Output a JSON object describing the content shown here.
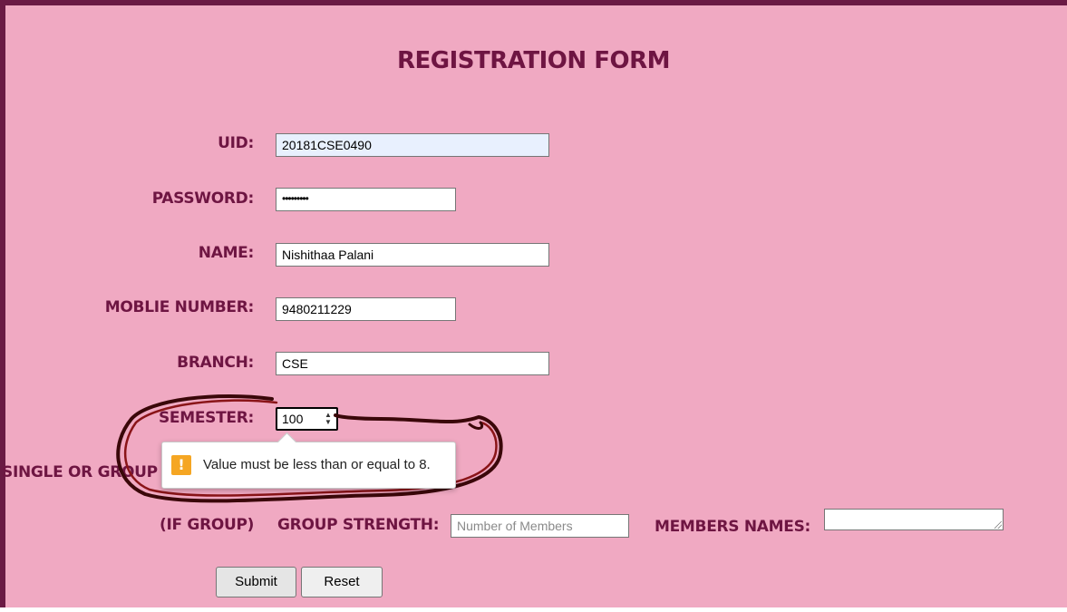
{
  "form": {
    "title": "REGISTRATION FORM",
    "fields": {
      "uid": {
        "label": "UID:",
        "value": "20181CSE0490"
      },
      "password": {
        "label": "PASSWORD:",
        "value": "•••••••••"
      },
      "name": {
        "label": "NAME:",
        "value": "Nishithaa Palani"
      },
      "mobile": {
        "label": "MOBLIE NUMBER:",
        "value": "9480211229"
      },
      "branch": {
        "label": "BRANCH:",
        "value": "CSE"
      },
      "semester": {
        "label": "SEMESTER:",
        "value": "100"
      },
      "mode": {
        "label": "SINGLE OR GROUP"
      },
      "group_prefix": {
        "label": "(IF GROUP)"
      },
      "group_strength": {
        "label": "GROUP STRENGTH:",
        "placeholder": "Number of Members"
      },
      "members_names": {
        "label": "MEMBERS NAMES:"
      }
    },
    "buttons": {
      "submit": "Submit",
      "reset": "Reset"
    }
  },
  "validation": {
    "message": "Value must be less than or equal to 8.",
    "icon": "warning-icon",
    "icon_glyph": "!"
  },
  "colors": {
    "frame": "#6b1a44",
    "background": "#f0a9c2",
    "label": "#6e1542",
    "warning": "#f5a623",
    "annotation": "#5a0d10"
  }
}
